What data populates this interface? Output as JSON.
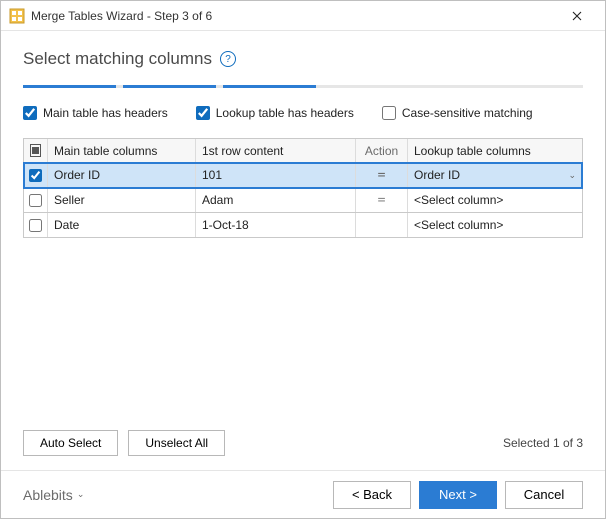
{
  "window": {
    "title": "Merge Tables Wizard - Step 3 of 6"
  },
  "heading": "Select matching columns",
  "progress": {
    "current": 3,
    "total": 6
  },
  "options": {
    "main_headers": {
      "label": "Main table has headers",
      "checked": true
    },
    "lookup_headers": {
      "label": "Lookup table has headers",
      "checked": true
    },
    "case_sensitive": {
      "label": "Case-sensitive matching",
      "checked": false
    }
  },
  "grid": {
    "headers": {
      "main": "Main table columns",
      "first_row": "1st row content",
      "action": "Action",
      "lookup": "Lookup table columns"
    },
    "rows": [
      {
        "checked": true,
        "main": "Order ID",
        "first_row": "101",
        "action": "=",
        "lookup": "Order ID",
        "selected": true,
        "focus": true
      },
      {
        "checked": false,
        "main": "Seller",
        "first_row": "Adam",
        "action": "=",
        "lookup": "<Select column>",
        "selected": false,
        "focus": false
      },
      {
        "checked": false,
        "main": "Date",
        "first_row": "1-Oct-18",
        "action": "",
        "lookup": "<Select column>",
        "selected": false,
        "focus": false
      }
    ]
  },
  "buttons": {
    "auto_select": "Auto Select",
    "unselect_all": "Unselect All"
  },
  "status": "Selected 1 of 3",
  "brand": "Ablebits",
  "nav": {
    "back": "< Back",
    "next": "Next >",
    "cancel": "Cancel"
  }
}
